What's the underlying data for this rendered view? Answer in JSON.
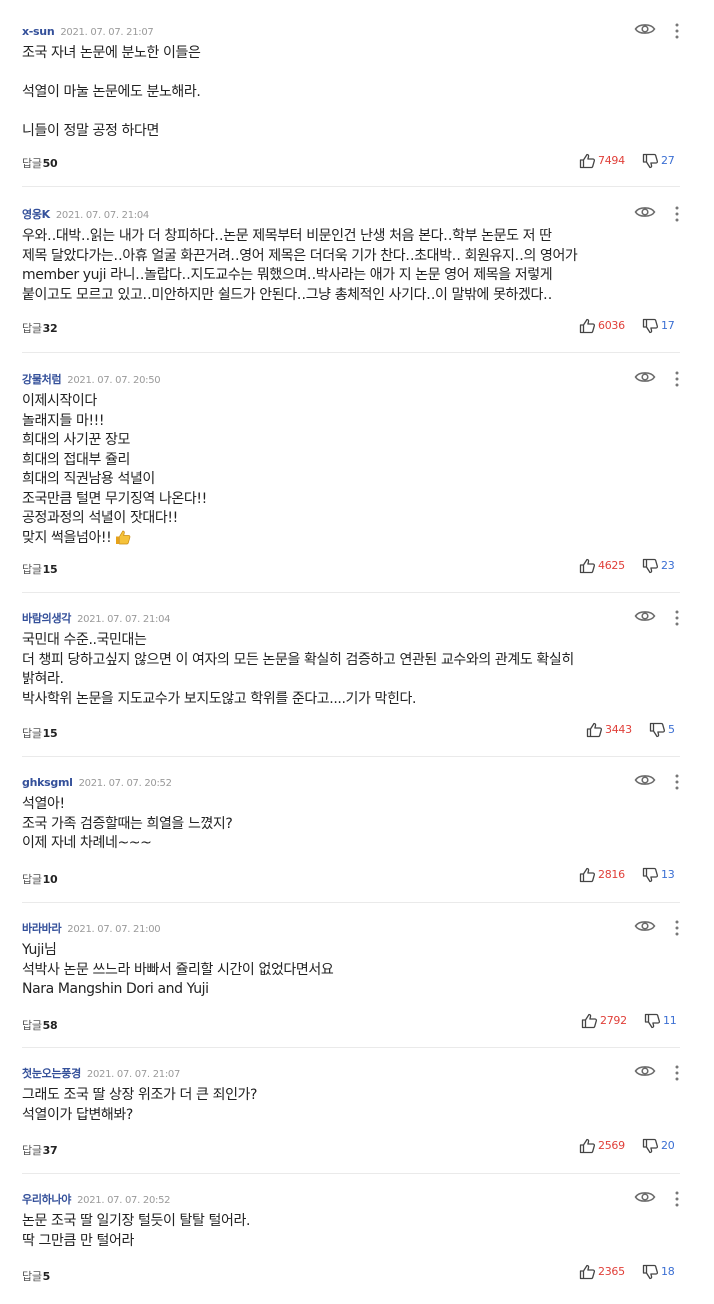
{
  "reply_label": "답글",
  "colors": {
    "nickname": "#34509a",
    "upvote": "#e0403a",
    "downvote": "#3b6fd3",
    "divider": "#eaeaea"
  },
  "comments": [
    {
      "nickname": "x-sun",
      "time": "2021. 07. 07. 21:07",
      "lines": [
        "조국 자녀 논문에 분노한 이들은",
        "",
        "석열이 마눌 논문에도 분노해라.",
        "",
        "니들이 정말 공정 하다면"
      ],
      "replies": "50",
      "likes": "7494",
      "dislikes": "27"
    },
    {
      "nickname": "영웅K",
      "time": "2021. 07. 07. 21:04",
      "lines": [
        "우와‥대박‥읽는 내가 더 창피하다‥논문 제목부터  비문인건 난생 처음 본다‥학부 논문도 저 딴",
        "제목 달았다가는‥아휴 얼굴 화끈거려‥영어 제목은 더더욱 기가 찬다‥초대박‥ 회원유지‥의 영어가",
        "member yuji 라니‥놀랍다‥지도교수는 뭐했으며‥박사라는 애가 지 논문 영어 제목을 저렇게",
        "붙이고도 모르고 있고‥미안하지만 쉴드가 안된다‥그냥 총체적인 사기다‥이 말밖에 못하겠다‥"
      ],
      "replies": "32",
      "likes": "6036",
      "dislikes": "17"
    },
    {
      "nickname": "강물처럼",
      "time": "2021. 07. 07. 20:50",
      "lines": [
        "이제시작이다",
        "놀래지들 마!!!",
        "희대의 사기꾼 장모",
        "희대의 접대부 쥴리",
        "희대의 직권남용 석녈이",
        "조국만큼 털면 무기징역 나온다!!",
        "공정과정의 석녈이 잣대다!!",
        "맞지 썩을넘아!!"
      ],
      "replies": "15",
      "likes": "4625",
      "dislikes": "23"
    },
    {
      "nickname": "바람의생각",
      "time": "2021. 07. 07. 21:04",
      "lines": [
        "국민대 수준..국민대는",
        "더 챙피 당하고싶지 않으면 이 여자의 모든 논문을 확실히 검증하고 연관된 교수와의 관계도 확실히",
        "밝혀라.",
        "박사학위 논문을 지도교수가 보지도않고 학위를 준다고....기가 막힌다."
      ],
      "replies": "15",
      "likes": "3443",
      "dislikes": "5"
    },
    {
      "nickname": "ghksgml",
      "time": "2021. 07. 07. 20:52",
      "lines": [
        "석열아!",
        "조국 가족 검증할때는 희열을 느꼈지?",
        "이제 자네 차례네~~~"
      ],
      "replies": "10",
      "likes": "2816",
      "dislikes": "13"
    },
    {
      "nickname": "바라바라",
      "time": "2021. 07. 07. 21:00",
      "lines": [
        "Yuji님",
        "석박사 논문 쓰느라 바빠서 쥴리할 시간이 없었다면서요",
        "Nara Mangshin Dori and Yuji"
      ],
      "replies": "58",
      "likes": "2792",
      "dislikes": "11"
    },
    {
      "nickname": "첫눈오는풍경",
      "time": "2021. 07. 07. 21:07",
      "lines": [
        "그래도 조국 딸 상장 위조가 더 큰 죄인가?",
        "석열이가 답변해봐?"
      ],
      "replies": "37",
      "likes": "2569",
      "dislikes": "20"
    },
    {
      "nickname": "우리하나야",
      "time": "2021. 07. 07. 20:52",
      "lines": [
        "논문  조국 딸 일기장 털듯이 탈탈 털어라.",
        "딱 그만큼 만 털어라"
      ],
      "replies": "5",
      "likes": "2365",
      "dislikes": "18"
    }
  ]
}
